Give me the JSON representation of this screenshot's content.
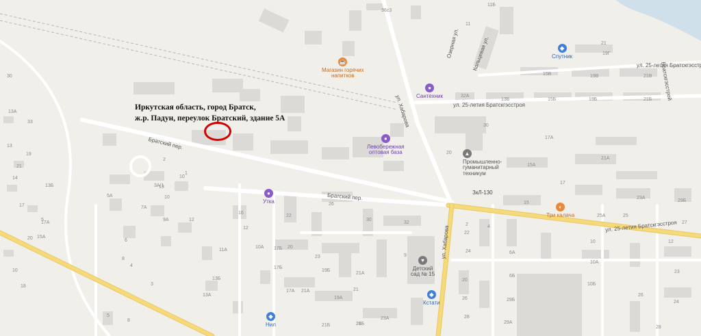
{
  "caption": {
    "line1": "Иркутская область, город Братск,",
    "line2": "ж.р. Падун, переулок Братский, здание 5А"
  },
  "colors": {
    "background": "#f1efea",
    "building": "#dcdad6",
    "road": "#ffffff",
    "main_road": "#f6d978",
    "marker": "#d40000",
    "poi_orange": "#e8893a",
    "poi_purple": "#8a5cc8",
    "poi_blue": "#3f7fd8"
  },
  "streets": [
    {
      "name": "ул. 25-летия Братскгэсстроя",
      "id": "a"
    },
    {
      "name": "ул. 25-летия Братскгэсстроя",
      "id": "b"
    },
    {
      "name": "ул. 25-летия Братскгэсстроя",
      "id": "c"
    },
    {
      "name": "ул. Хабарова",
      "id": "d"
    },
    {
      "name": "ул. Хабарова",
      "id": "e"
    },
    {
      "name": "Братский пер.",
      "id": "f"
    },
    {
      "name": "Братский пер.",
      "id": "g"
    },
    {
      "name": "Кольцевая ул.",
      "id": "h"
    },
    {
      "name": "Озерная ул.",
      "id": "i"
    },
    {
      "name": "Братскгэсстрой",
      "id": "j"
    }
  ],
  "pois": [
    {
      "name": "Магазин горячих напитков",
      "line1": "Магазин горячих",
      "line2": "напитков",
      "icon": "cup-icon"
    },
    {
      "name": "Сантехник",
      "line1": "Сантехник",
      "line2": "",
      "icon": "shop-icon"
    },
    {
      "name": "Спутник",
      "line1": "Спутник",
      "line2": "",
      "icon": "basket-icon"
    },
    {
      "name": "Левобережная оптовая база",
      "line1": "Левобережная",
      "line2": "оптовая база",
      "icon": "shop-icon"
    },
    {
      "name": "Промышленно-гуманитарный техникум",
      "line1": "Промышленно-",
      "line2": "гуманитарный",
      "line3": "техникум",
      "icon": "school-icon"
    },
    {
      "name": "Утка",
      "line1": "Утка",
      "line2": "",
      "icon": "shop-icon"
    },
    {
      "name": "Три калача",
      "line1": "Три калача",
      "line2": "",
      "icon": "bakery-icon"
    },
    {
      "name": "Детский сад № 15",
      "line1": "Детский",
      "line2": "сад № 15",
      "icon": "kindergarten-icon"
    },
    {
      "name": "Кстати",
      "line1": "Кстати",
      "line2": "",
      "icon": "basket-icon"
    },
    {
      "name": "Нил",
      "line1": "Нил",
      "line2": "",
      "icon": "basket-icon"
    }
  ],
  "stop": "ЗкЛ-130",
  "house_numbers": [
    "36с3",
    "11Б",
    "11",
    "21",
    "19Г",
    "15В",
    "19В",
    "21В",
    "32А",
    "13Б",
    "15Б",
    "19Б",
    "21Б",
    "30",
    "17А",
    "20",
    "21А",
    "15А",
    "17",
    "23А",
    "29Б",
    "15",
    "25А",
    "25",
    "27",
    "26",
    "30",
    "32",
    "22",
    "16",
    "10",
    "10А",
    "11А",
    "12",
    "13",
    "13Б",
    "13А",
    "17Б",
    "17А",
    "19А",
    "19Б",
    "17Б",
    "20",
    "21А",
    "23",
    "23А",
    "21Б",
    "21Б",
    "24",
    "22",
    "26",
    "28",
    "29Б",
    "29А",
    "6А",
    "6Б",
    "10",
    "10А",
    "10Б",
    "12",
    "2",
    "4",
    "5",
    "8",
    "9",
    "20",
    "23",
    "24",
    "26",
    "28",
    "30",
    "33",
    "19",
    "21",
    "17",
    "14",
    "13",
    "13А",
    "12",
    "10",
    "9А",
    "8",
    "7А",
    "5А",
    "3А/1",
    "6",
    "4",
    "3",
    "2",
    "1",
    "28",
    "21",
    "21А",
    "17А",
    "15А",
    "13Б",
    "5",
    "10",
    "20",
    "18"
  ]
}
